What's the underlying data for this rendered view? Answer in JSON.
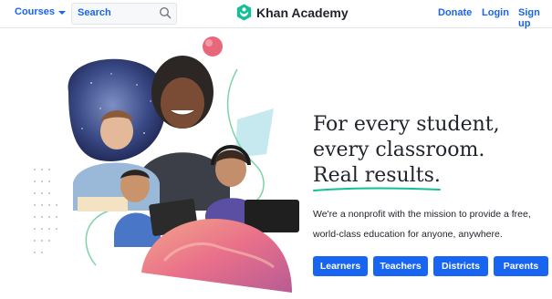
{
  "header": {
    "courses_label": "Courses",
    "search_placeholder": "Search",
    "brand_name": "Khan Academy",
    "donate_label": "Donate",
    "login_label": "Login",
    "signup_label": "Sign up"
  },
  "hero": {
    "headline_line1": "For every student,",
    "headline_line2": "every classroom.",
    "headline_line3": "Real results.",
    "blurb_line1": "We're a nonprofit with the mission to provide a free,",
    "blurb_line2": "world-class education for anyone, anywhere.",
    "buttons": [
      "Learners",
      "Teachers",
      "Districts",
      "Parents"
    ]
  },
  "colors": {
    "accent": "#1865f2",
    "brand_green": "#14bf96",
    "text": "#21242c"
  },
  "icons": {
    "search": "magnifier",
    "logo": "hexagon-leaf"
  }
}
